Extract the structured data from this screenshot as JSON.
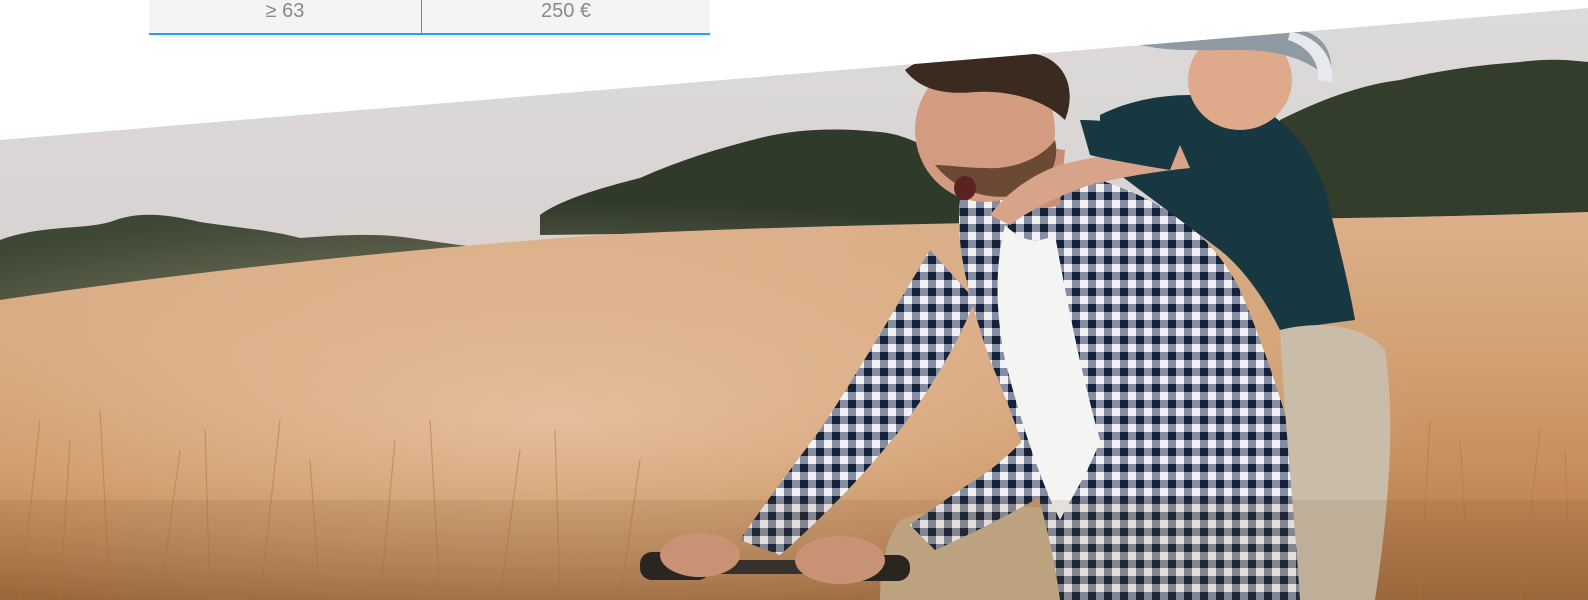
{
  "table": {
    "rows": [
      {
        "col1": "≥ 63",
        "col2": "250 €"
      }
    ]
  },
  "hero": {
    "image_name": "father-and-son-biking-in-field-photo",
    "colors": {
      "sky": "#d7d4d3",
      "field": "#cc9a6b",
      "trees": "#37402f",
      "shirt": "#1d2d4a",
      "boy_shirt": "#183a44",
      "accent": "#22a4e8"
    }
  }
}
